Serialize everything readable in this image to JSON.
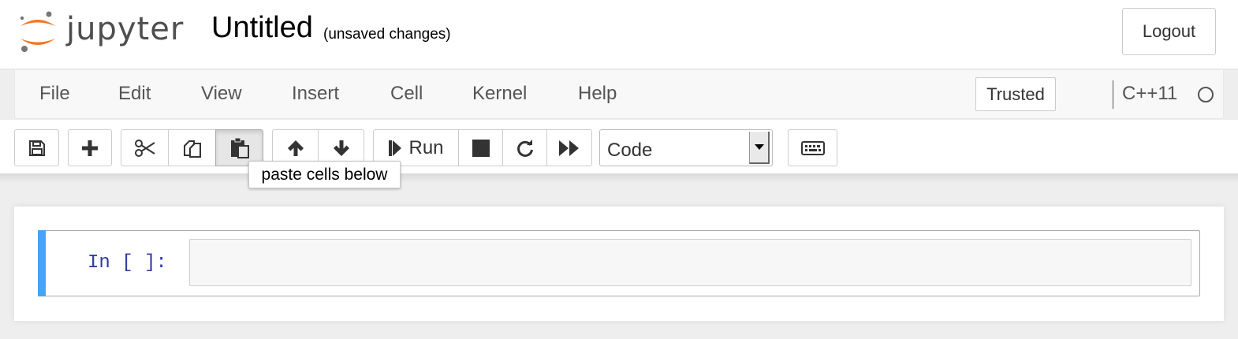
{
  "header": {
    "logo_text": "jupyter",
    "notebook_title": "Untitled",
    "save_status": "(unsaved changes)",
    "logout_label": "Logout"
  },
  "menubar": {
    "items": [
      {
        "label": "File"
      },
      {
        "label": "Edit"
      },
      {
        "label": "View"
      },
      {
        "label": "Insert"
      },
      {
        "label": "Cell"
      },
      {
        "label": "Kernel"
      },
      {
        "label": "Help"
      }
    ],
    "trusted_label": "Trusted",
    "kernel_name": "C++11",
    "kernel_status": "idle"
  },
  "toolbar": {
    "buttons": [
      {
        "icon": "save-icon"
      },
      {
        "icon": "plus-icon"
      },
      {
        "icon": "cut-icon"
      },
      {
        "icon": "copy-icon"
      },
      {
        "icon": "paste-icon",
        "active": true
      },
      {
        "icon": "arrow-up-icon"
      },
      {
        "icon": "arrow-down-icon"
      },
      {
        "icon": "step-forward-icon"
      },
      {
        "icon": "stop-icon"
      },
      {
        "icon": "refresh-icon"
      },
      {
        "icon": "fast-forward-icon"
      },
      {
        "icon": "keyboard-icon"
      }
    ],
    "run_label": "Run",
    "cell_type": {
      "selected": "Code"
    },
    "tooltip": "paste cells below"
  },
  "cell": {
    "prompt": "In [ ]:",
    "content": "",
    "selected_color": "#42a5f5"
  },
  "colors": {
    "logo_orange": "#f37726",
    "logo_gray": "#767677",
    "prompt_blue": "#303f9f"
  }
}
